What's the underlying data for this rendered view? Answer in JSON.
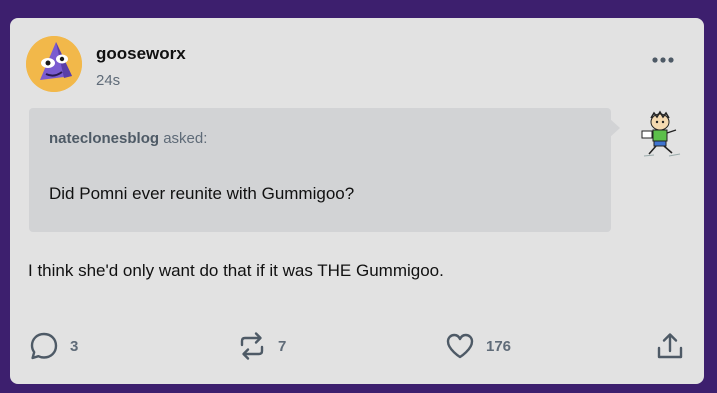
{
  "post": {
    "blog_name": "gooseworx",
    "timestamp": "24s",
    "ask": {
      "asker": "nateclonesblog",
      "asked_label": "asked:",
      "question": "Did Pomni ever reunite with Gummigoo?"
    },
    "answer": "I think she'd only want do that if it was THE Gummigoo."
  },
  "footer": {
    "reply_count": "3",
    "reblog_count": "7",
    "like_count": "176"
  },
  "icons": {
    "more": "more-options-icon",
    "reply": "reply-bubble-icon",
    "reblog": "reblog-icon",
    "like": "heart-icon",
    "share": "share-icon"
  },
  "colors": {
    "background": "#3d1f6e",
    "card": "#e2e2e2",
    "ask_box": "#d2d3d5",
    "muted_text": "#5f6b78"
  }
}
